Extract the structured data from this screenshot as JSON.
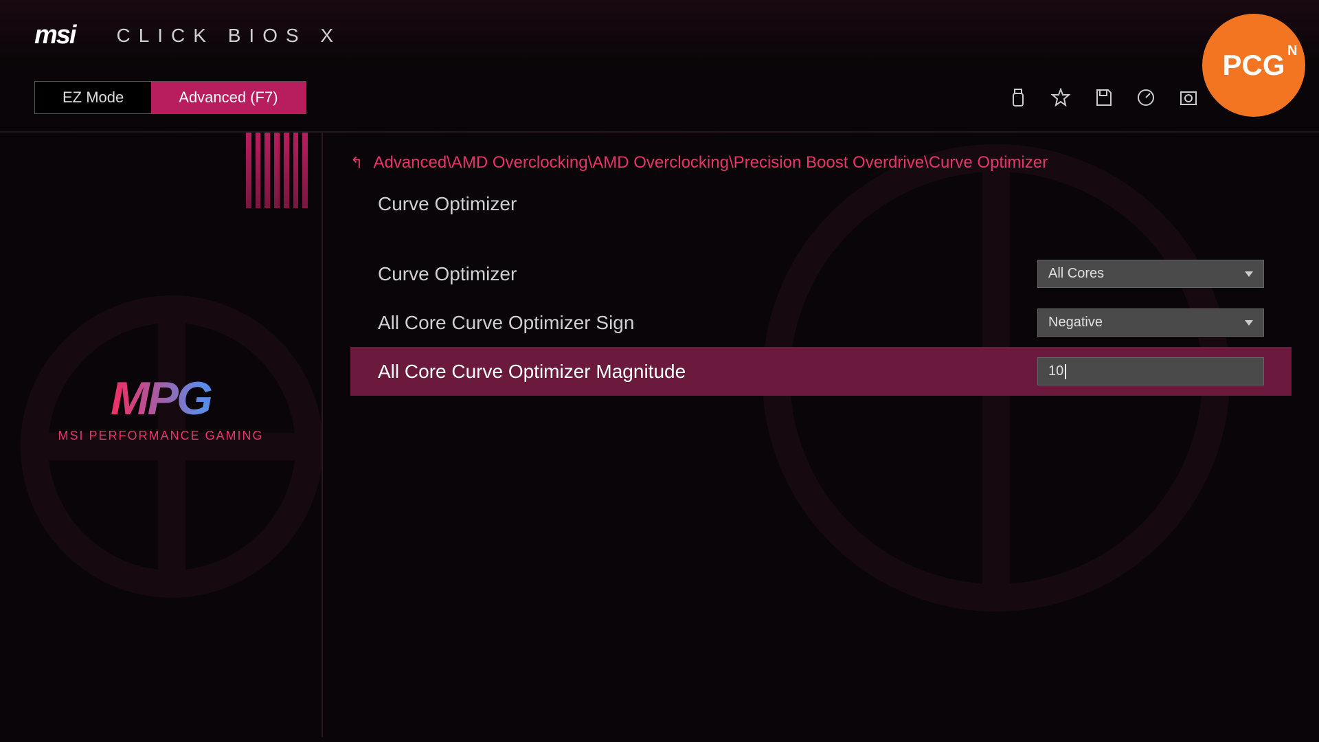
{
  "header": {
    "brand": "msi",
    "title": "CLICK BIOS X"
  },
  "modes": {
    "ez": "EZ Mode",
    "advanced": "Advanced (F7)"
  },
  "sidebar": {
    "mpg": "MPG",
    "mpg_subtitle": "MSI PERFORMANCE GAMING"
  },
  "breadcrumb": "Advanced\\AMD Overclocking\\AMD Overclocking\\Precision Boost Overdrive\\Curve Optimizer",
  "section_title": "Curve Optimizer",
  "settings": [
    {
      "label": "Curve Optimizer",
      "value": "All Cores",
      "type": "dropdown"
    },
    {
      "label": "All Core Curve Optimizer Sign",
      "value": "Negative",
      "type": "dropdown"
    },
    {
      "label": "All Core Curve Optimizer Magnitude",
      "value": "10",
      "type": "input",
      "selected": true
    }
  ],
  "watermark": {
    "main": "PCG",
    "sup": "N"
  },
  "colors": {
    "accent": "#b81d5e",
    "highlight": "#e8336b",
    "badge": "#f47521"
  }
}
